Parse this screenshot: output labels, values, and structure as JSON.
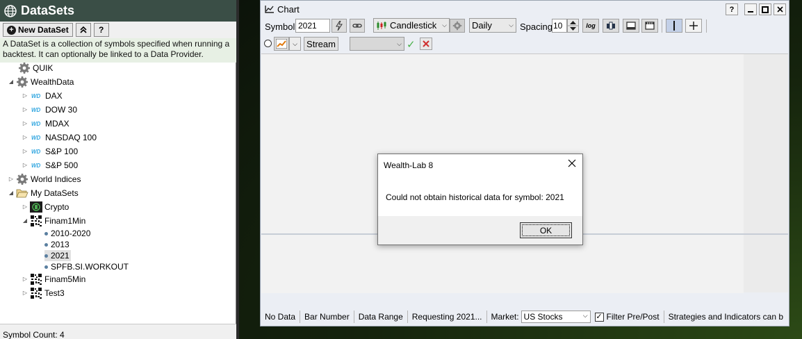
{
  "datasets": {
    "title": "DataSets",
    "new_button": "New DataSet",
    "collapse_button": "⮆",
    "help_button": "?",
    "description": "A DataSet is a collection of symbols specified when running a backtest. It can optionally be linked to a Data Provider.",
    "tree": {
      "quik": "QUIK",
      "wealthdata": "WealthData",
      "wd_badge": "WD",
      "dax": "DAX",
      "dow30": "DOW 30",
      "mdax": "MDAX",
      "nasdaq100": "NASDAQ 100",
      "sp100": "S&P 100",
      "sp500": "S&P 500",
      "world_indices": "World Indices",
      "my_datasets": "My DataSets",
      "crypto": "Crypto",
      "finam1min": "Finam1Min",
      "sym_2010_2020": "2010-2020",
      "sym_2013": "2013",
      "sym_2021": "2021",
      "sym_spfb": "SPFB.SI.WORKOUT",
      "finam5min": "Finam5Min",
      "test3": "Test3"
    },
    "status": "Symbol Count: 4"
  },
  "chart": {
    "title": "Chart",
    "help": "?",
    "symbol_label": "Symbol",
    "symbol_value": "2021",
    "chart_style": "Candlestick",
    "scale": "Daily",
    "spacing_label": "Spacing",
    "spacing_value": "10",
    "log_label": "log",
    "stream_button": "Stream",
    "status": {
      "no_data": "No Data",
      "bar_number": "Bar Number",
      "data_range": "Data Range",
      "requesting": "Requesting 2021...",
      "market_label": "Market:",
      "market_value": "US Stocks",
      "filter_label": "Filter Pre/Post",
      "strategies_hint": "Strategies and Indicators can b"
    }
  },
  "dialog": {
    "title": "Wealth-Lab 8",
    "message": "Could not obtain historical data for symbol: 2021",
    "ok_label": "OK",
    "close": "✕"
  },
  "icons": {
    "globe": "globe-icon",
    "gear": "gear-icon",
    "folder": "folder-open-icon"
  }
}
